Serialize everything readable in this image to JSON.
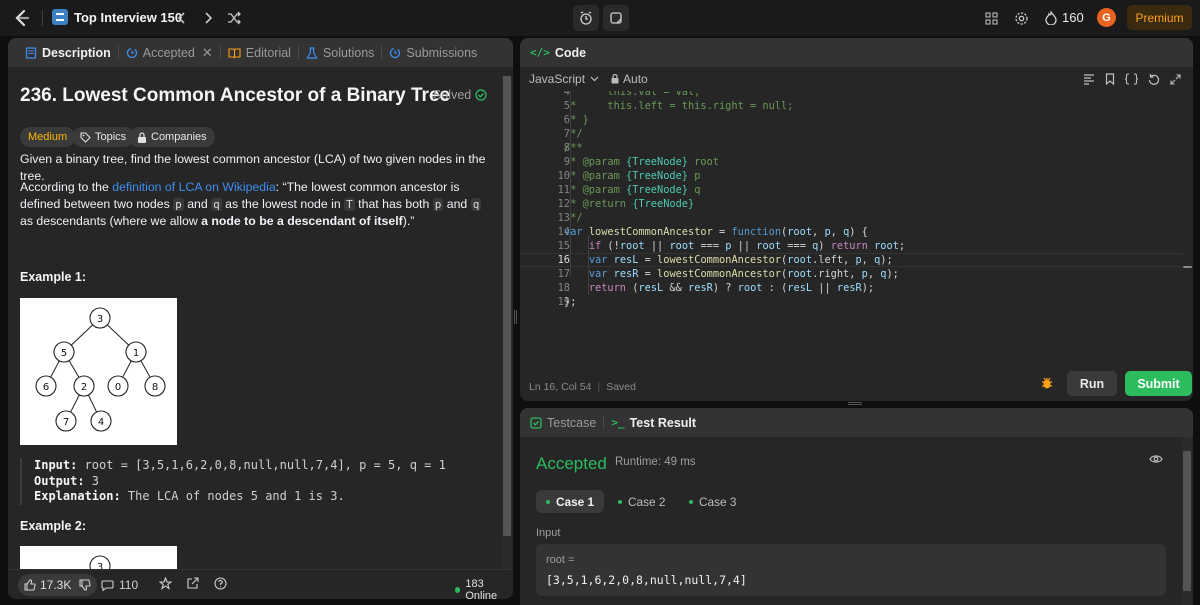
{
  "topbar": {
    "list_title": "Top Interview 150",
    "prev_icon": "chevron-left-icon",
    "next_icon": "chevron-right-icon",
    "shuffle_icon": "shuffle-icon",
    "streak_count": "160",
    "avatar_initial": "G",
    "premium_label": "Premium",
    "accent_color": "#ffa116"
  },
  "left_panel": {
    "tabs": [
      {
        "label": "Description",
        "icon": "description-icon"
      },
      {
        "label": "Accepted",
        "icon": "history-icon"
      },
      {
        "label": "Editorial",
        "icon": "book-icon"
      },
      {
        "label": "Solutions",
        "icon": "flask-icon"
      },
      {
        "label": "Submissions",
        "icon": "history-icon"
      }
    ],
    "problem": {
      "title": "236. Lowest Common Ancestor of a Binary Tree",
      "solved_label": "Solved",
      "difficulty": "Medium",
      "topics_label": "Topics",
      "companies_label": "Companies",
      "intro": "Given a binary tree, find the lowest common ancestor (LCA) of two given nodes in the tree.",
      "para2_prefix": "According to the ",
      "para2_link": "definition of LCA on Wikipedia",
      "para2_a": ": “The lowest common ancestor is defined between two nodes ",
      "para2_p": "p",
      "para2_and": " and ",
      "para2_q": "q",
      "para2_b": " as the lowest node in ",
      "para2_T": "T",
      "para2_c": " that has both ",
      "para2_d": " as descendants (where we allow ",
      "para2_bold": "a node to be a descendant of itself",
      "para2_end": ").”",
      "example1_title": "Example 1:",
      "example1_tree": [
        "3",
        "5",
        "1",
        "6",
        "2",
        "0",
        "8",
        "7",
        "4"
      ],
      "example1_input_label": "Input:",
      "example1_input": " root = [3,5,1,6,2,0,8,null,null,7,4], p = 5, q = 1",
      "example1_output_label": "Output:",
      "example1_output": " 3",
      "example1_expl_label": "Explanation:",
      "example1_expl": " The LCA of nodes 5 and 1 is 3.",
      "example2_title": "Example 2:",
      "example2_root": "3"
    },
    "bottom": {
      "likes": "17.3K",
      "comments": "110",
      "online": "183 Online"
    }
  },
  "code_panel": {
    "title": "Code",
    "language": "JavaScript",
    "mode": "Auto",
    "status_pos": "Ln 16, Col 54",
    "status_saved": "Saved",
    "run_label": "Run",
    "submit_label": "Submit",
    "lines": [
      {
        "n": "4",
        "t": " *     this.val = val;"
      },
      {
        "n": "5",
        "t": " *     this.left = this.right = null;"
      },
      {
        "n": "6",
        "t": " * }"
      },
      {
        "n": "7",
        "t": " */"
      },
      {
        "n": "8",
        "t": "/**"
      },
      {
        "n": "9",
        "t": " * @param {TreeNode} root"
      },
      {
        "n": "10",
        "t": " * @param {TreeNode} p"
      },
      {
        "n": "11",
        "t": " * @param {TreeNode} q"
      },
      {
        "n": "12",
        "t": " * @return {TreeNode}"
      },
      {
        "n": "13",
        "t": " */"
      },
      {
        "n": "14",
        "t": "var lowestCommonAncestor = function(root, p, q) {"
      },
      {
        "n": "15",
        "t": "    if (!root || root === p || root === q) return root;"
      },
      {
        "n": "16",
        "t": "    var resL = lowestCommonAncestor(root.left, p, q);"
      },
      {
        "n": "17",
        "t": "    var resR = lowestCommonAncestor(root.right, p, q);"
      },
      {
        "n": "18",
        "t": "    return (resL && resR) ? root : (resL || resR);"
      },
      {
        "n": "19",
        "t": "};"
      }
    ]
  },
  "result_panel": {
    "tab_testcase": "Testcase",
    "tab_result": "Test Result",
    "verdict": "Accepted",
    "runtime": "Runtime: 49 ms",
    "cases": [
      "Case 1",
      "Case 2",
      "Case 3"
    ],
    "input_label": "Input",
    "input_var": "root =",
    "input_value": "[3,5,1,6,2,0,8,null,null,7,4]"
  }
}
